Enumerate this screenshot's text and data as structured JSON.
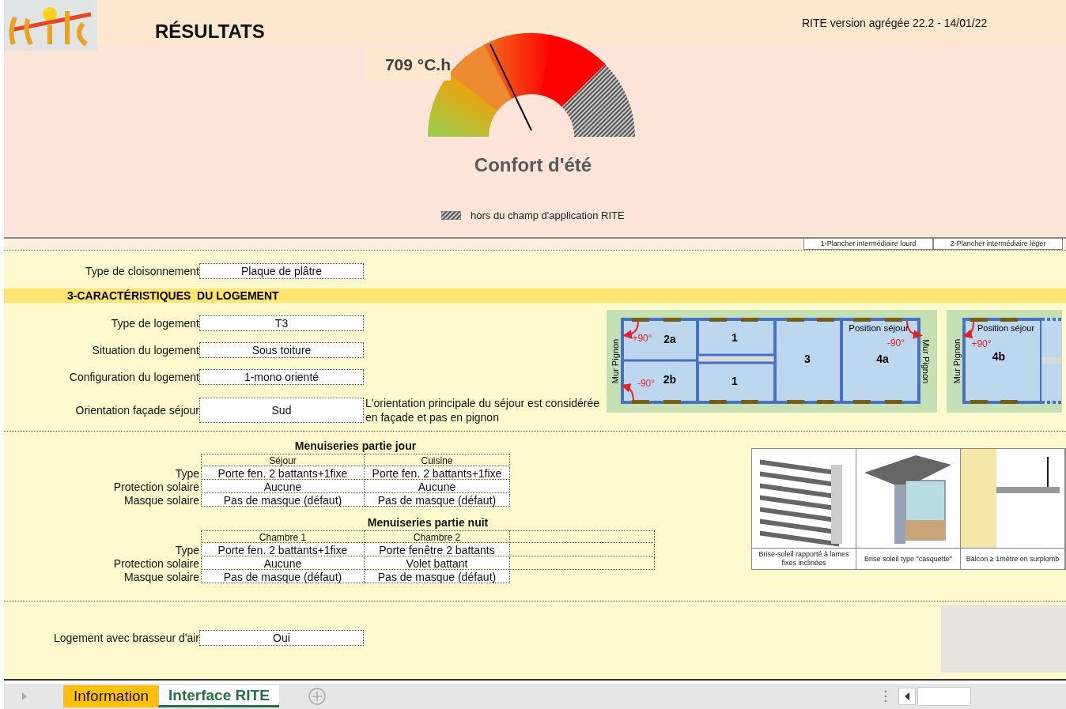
{
  "header": {
    "title": "RÉSULTATS",
    "version": "RITE version agrégée 22.2 - 14/01/22"
  },
  "gauge": {
    "reading": "709 °C.h",
    "title": "Confort d'été",
    "legend": "hors du champ d'application RITE"
  },
  "floor_options": [
    "1-Plancher intermédiaire lourd",
    "2-Plancher intermédiaire léger"
  ],
  "partition": {
    "label": "Type de cloisonnement",
    "value": "Plaque de plâtre"
  },
  "section_title": "3-CARACTÉRISTIQUES  DU LOGEMENT",
  "housing_fields": [
    {
      "label": "Type de logement",
      "value": "T3"
    },
    {
      "label": "Situation du logement",
      "value": "Sous toiture"
    },
    {
      "label": "Configuration du logement",
      "value": "1-mono orienté"
    },
    {
      "label": "Orientation façade séjour",
      "value": "Sud",
      "note": "L'orientation principale du séjour est considérée en façade et pas en pignon"
    }
  ],
  "floor_plans": [
    {
      "rooms": [
        "2a",
        "2b",
        "1",
        "1",
        "3",
        "4a"
      ],
      "angles": [
        "+90°",
        "-90°",
        "-90°"
      ],
      "position_label": "Position séjour",
      "wall_labels": [
        "Mur Pignon",
        "Mur Pignon"
      ]
    },
    {
      "rooms": [
        "4b"
      ],
      "angles": [
        "+90°"
      ],
      "position_label": "Position séjour",
      "wall_labels": [
        "Mur Pignon"
      ]
    }
  ],
  "menuiseries": [
    {
      "title": "Menuiseries partie jour",
      "columns": [
        "Séjour",
        "Cuisine"
      ],
      "rows": [
        {
          "label": "Type",
          "values": [
            "Porte fen. 2 battants+1fixe",
            "Porte fen. 2 battants+1fixe"
          ]
        },
        {
          "label": "Protection solaire",
          "values": [
            "Aucune",
            "Aucune"
          ]
        },
        {
          "label": "Masque solaire",
          "values": [
            "Pas de masque (défaut)",
            "Pas de masque (défaut)"
          ]
        }
      ]
    },
    {
      "title": "Menuiseries partie nuit",
      "columns": [
        "Chambre 1",
        "Chambre 2"
      ],
      "rows": [
        {
          "label": "Type",
          "values": [
            "Porte fen. 2 battants+1fixe",
            "Porte fenêtre 2 battants"
          ]
        },
        {
          "label": "Protection solaire",
          "values": [
            "Aucune",
            "Volet battant"
          ]
        },
        {
          "label": "Masque solaire",
          "values": [
            "Pas de masque (défaut)",
            "Pas de masque (défaut)"
          ]
        }
      ]
    }
  ],
  "illustrations": [
    {
      "caption": "Brise-soleil rapporté à lames fixes inclinées"
    },
    {
      "caption": "Brise soleil type \"casquette\""
    },
    {
      "caption": "Balcon ≥ 1mètre en surplomb"
    }
  ],
  "fan": {
    "label": "Logement avec brasseur d'air",
    "value": "Oui"
  },
  "tabs": [
    {
      "label": "Information",
      "selected": false,
      "color": "#ffc000"
    },
    {
      "label": "Interface RITE",
      "selected": true,
      "color": "#217346"
    }
  ]
}
